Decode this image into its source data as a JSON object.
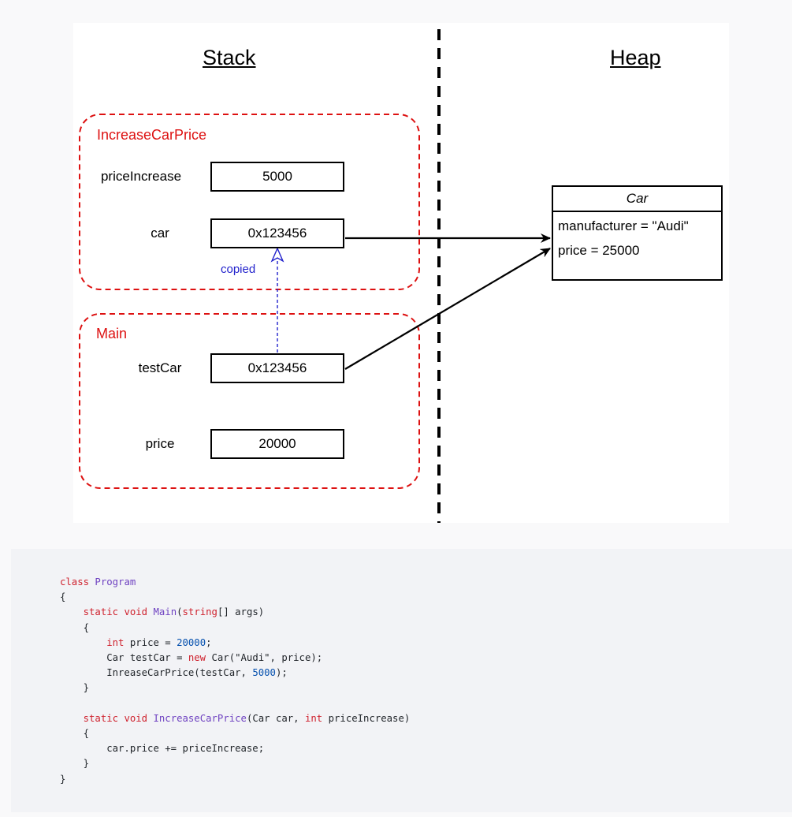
{
  "diagram": {
    "stack_heading": "Stack",
    "heap_heading": "Heap",
    "frames": [
      {
        "title": "IncreaseCarPrice",
        "variables": [
          {
            "name": "priceIncrease",
            "value": "5000"
          },
          {
            "name": "car",
            "value": "0x123456"
          }
        ]
      },
      {
        "title": "Main",
        "variables": [
          {
            "name": "testCar",
            "value": "0x123456"
          },
          {
            "name": "price",
            "value": "20000"
          }
        ]
      }
    ],
    "copied_label": "copied",
    "heap_object": {
      "class_name": "Car",
      "fields": [
        "manufacturer = \"Audi\"",
        "price = 25000"
      ]
    },
    "colors": {
      "frame_border": "#dd1111",
      "copied_arrow": "#2222cc",
      "divider": "#000000"
    }
  },
  "code": {
    "language": "csharp",
    "lines": [
      [
        {
          "t": "class ",
          "c": "kw"
        },
        {
          "t": "Program",
          "c": "ty"
        }
      ],
      [
        {
          "t": "{"
        }
      ],
      [
        {
          "t": "    "
        },
        {
          "t": "static ",
          "c": "kw"
        },
        {
          "t": "void ",
          "c": "kw"
        },
        {
          "t": "Main",
          "c": "ty"
        },
        {
          "t": "("
        },
        {
          "t": "string",
          "c": "kw"
        },
        {
          "t": "[] args)"
        }
      ],
      [
        {
          "t": "    {"
        }
      ],
      [
        {
          "t": "        "
        },
        {
          "t": "int ",
          "c": "kw"
        },
        {
          "t": "price = "
        },
        {
          "t": "20000",
          "c": "num"
        },
        {
          "t": ";"
        }
      ],
      [
        {
          "t": "        Car testCar = "
        },
        {
          "t": "new ",
          "c": "kw"
        },
        {
          "t": "Car(\"Audi\", price);"
        }
      ],
      [
        {
          "t": "        InreaseCarPrice(testCar, "
        },
        {
          "t": "5000",
          "c": "num"
        },
        {
          "t": ");"
        }
      ],
      [
        {
          "t": "    }"
        }
      ],
      [
        {
          "t": ""
        }
      ],
      [
        {
          "t": "    "
        },
        {
          "t": "static ",
          "c": "kw"
        },
        {
          "t": "void ",
          "c": "kw"
        },
        {
          "t": "IncreaseCarPrice",
          "c": "ty"
        },
        {
          "t": "(Car car, "
        },
        {
          "t": "int ",
          "c": "kw"
        },
        {
          "t": "priceIncrease)"
        }
      ],
      [
        {
          "t": "    {"
        }
      ],
      [
        {
          "t": "        car.price += priceIncrease;"
        }
      ],
      [
        {
          "t": "    }"
        }
      ],
      [
        {
          "t": "}"
        }
      ]
    ]
  }
}
